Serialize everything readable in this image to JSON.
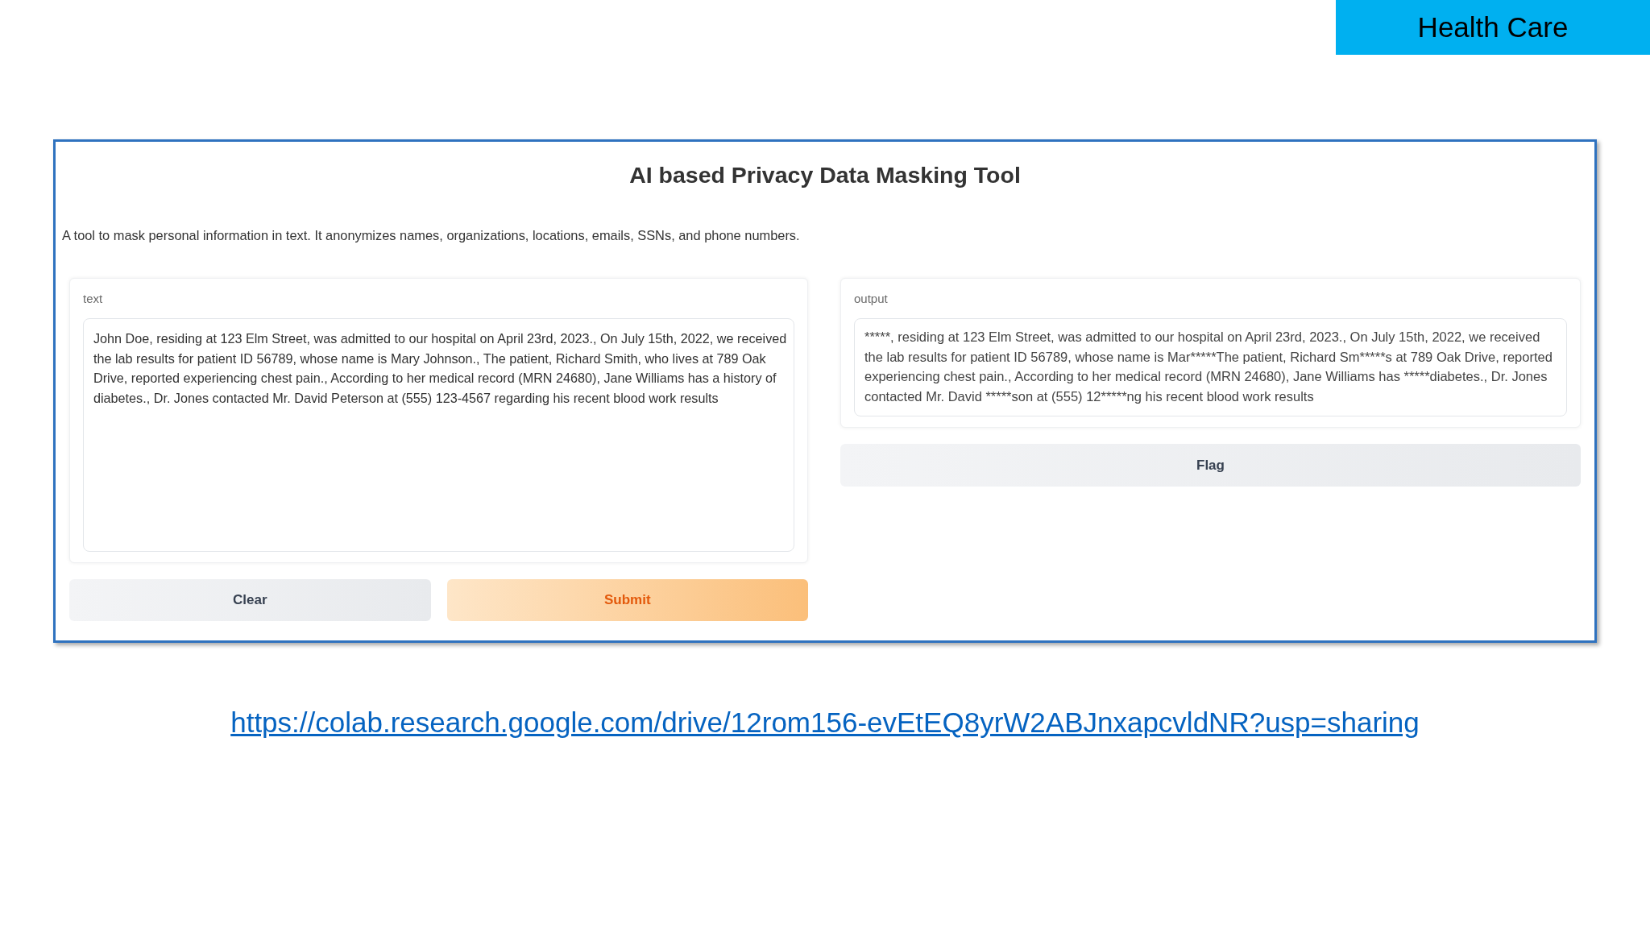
{
  "tag": {
    "label": "Health Care"
  },
  "app": {
    "title": "AI based Privacy Data Masking Tool",
    "description": "A tool to mask personal information in text. It anonymizes names, organizations, locations, emails, SSNs, and phone numbers.",
    "input": {
      "label": "text",
      "value": "John Doe, residing at 123 Elm Street, was admitted to our hospital on April 23rd, 2023., On July 15th, 2022, we received the lab results for patient ID 56789, whose name is Mary Johnson., The patient, Richard Smith, who lives at 789 Oak Drive, reported experiencing chest pain., According to her medical record (MRN 24680), Jane Williams has a history of diabetes., Dr. Jones contacted Mr. David Peterson at (555) 123-4567 regarding his recent blood work results"
    },
    "actions": [
      {
        "label": "Clear",
        "kind": "secondary"
      },
      {
        "label": "Submit",
        "kind": "primary"
      }
    ],
    "output": {
      "label": "output",
      "value": "*****, residing at 123 Elm Street, was admitted to our hospital on April 23rd, 2023., On July 15th, 2022, we received the lab results for patient ID 56789, whose name is Mar*****The patient, Richard Sm*****s at 789 Oak Drive, reported experiencing chest pain., According to her medical record (MRN 24680), Jane Williams has *****diabetes., Dr. Jones contacted Mr. David *****son at (555) 12*****ng his recent blood work results"
    },
    "flag": {
      "label": "Flag",
      "kind": "secondary"
    }
  },
  "link": {
    "url": "https://colab.research.google.com/drive/12rom156-evEtEQ8yrW2ABJnxapcvldNR?usp=sharing"
  }
}
